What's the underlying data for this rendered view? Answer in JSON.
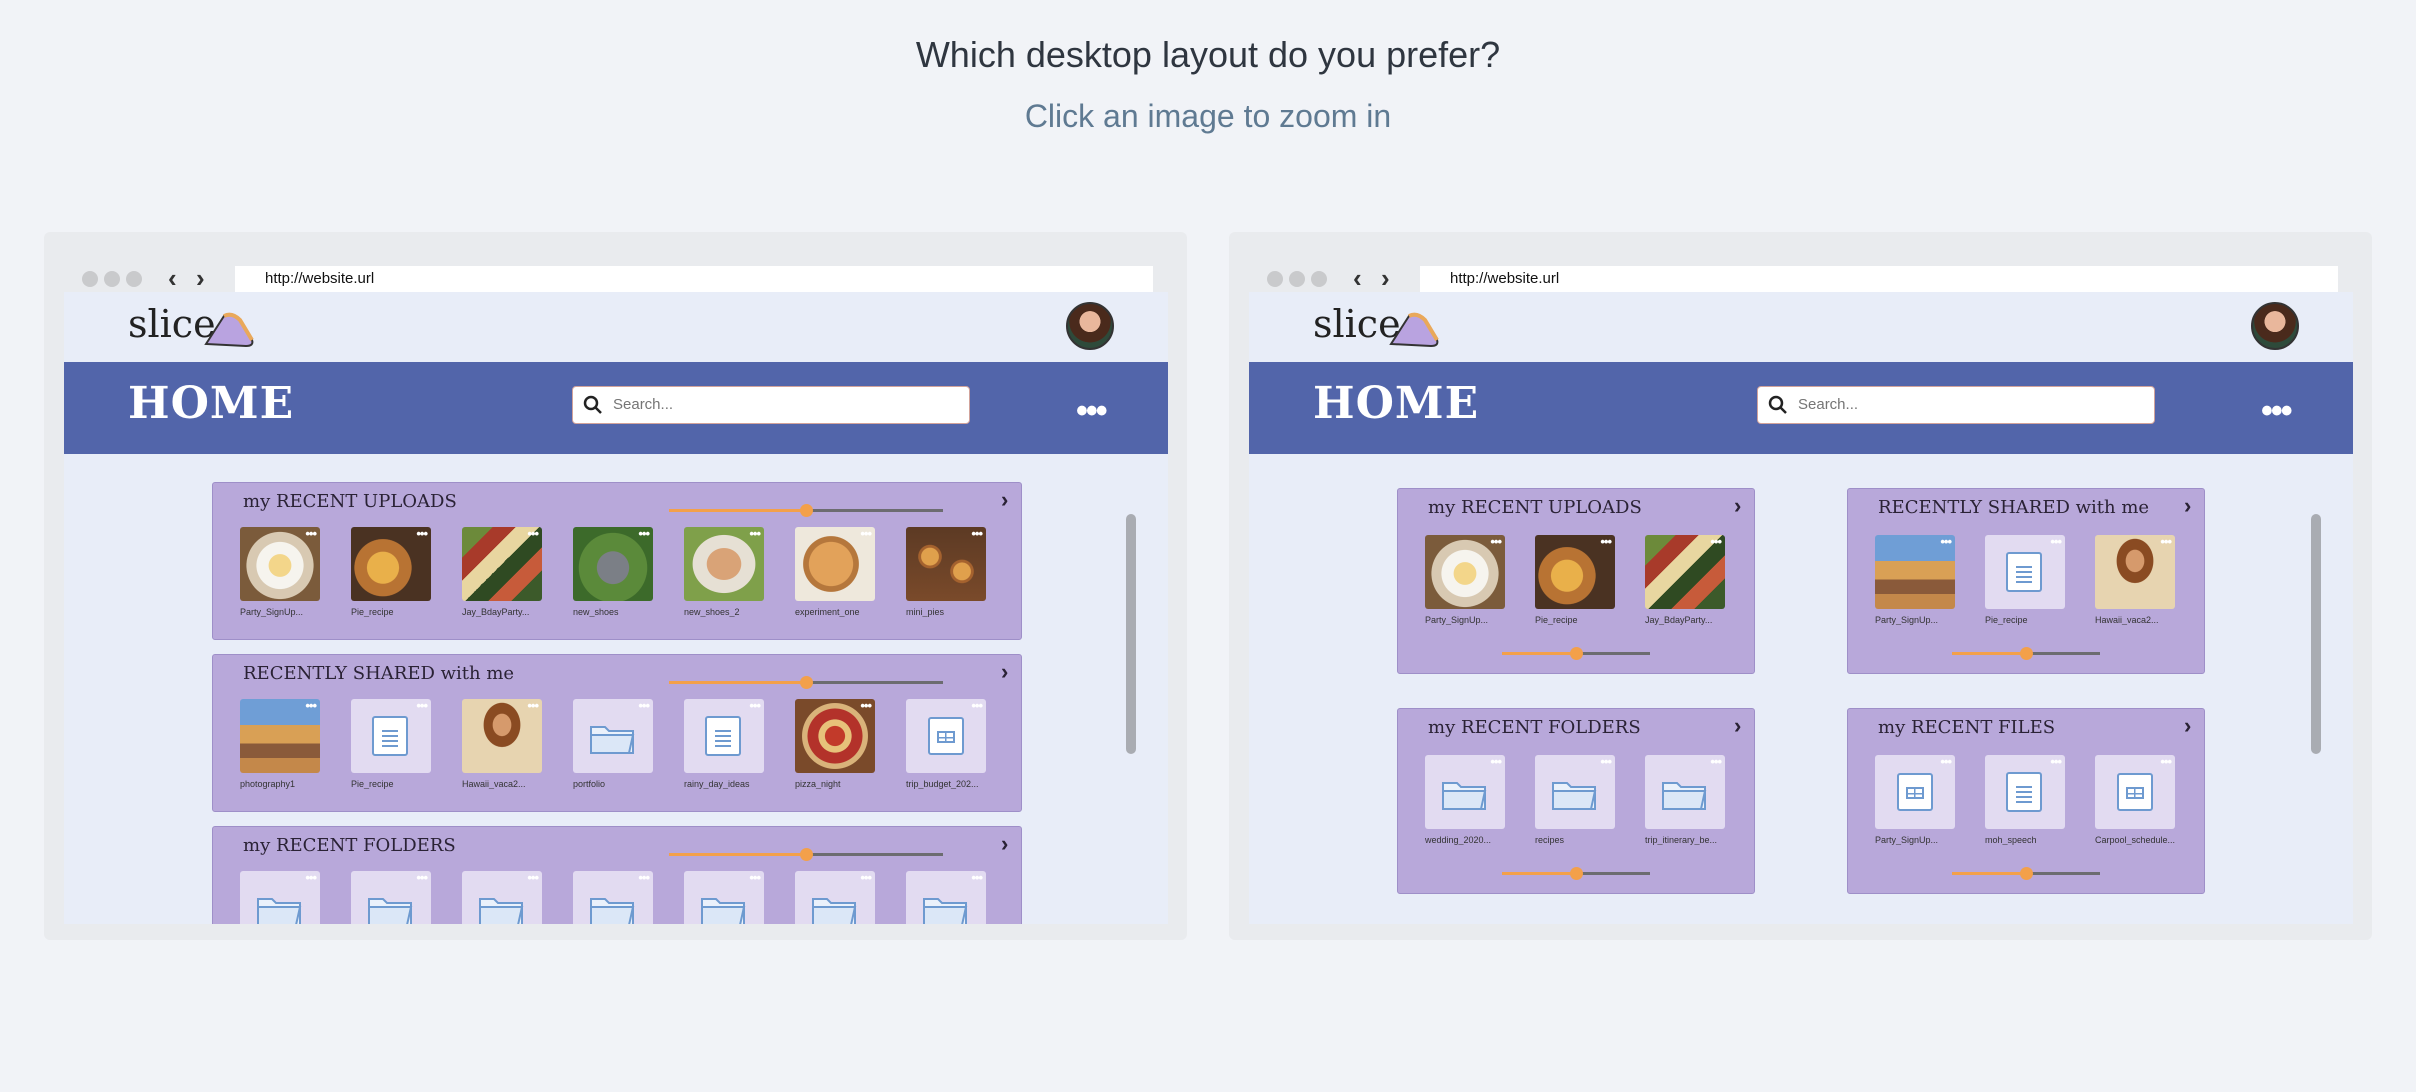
{
  "page": {
    "question": "Which desktop layout do you prefer?",
    "instruction": "Click an image to zoom in"
  },
  "browser": {
    "url": "http://website.url",
    "back_icon": "chevron-left-icon",
    "forward_icon": "chevron-right-icon"
  },
  "site": {
    "logo_text": "slice",
    "logo_icon": "pie-slice-icon",
    "header_title": "HOME",
    "search_placeholder": "Search...",
    "more_icon": "more-dots-icon",
    "colors": {
      "header": "#5265aa",
      "panel": "#b8a8da",
      "accent": "#f3a04a",
      "background": "#e8edf8"
    }
  },
  "layout_a": {
    "sections": [
      {
        "title": "my RECENT UPLOADS",
        "slider_value": 0.5,
        "items": [
          {
            "label": "Party_SignUp...",
            "kind": "image",
            "img": "food1"
          },
          {
            "label": "Pie_recipe",
            "kind": "image",
            "img": "food2"
          },
          {
            "label": "Jay_BdayParty...",
            "kind": "image",
            "img": "food3"
          },
          {
            "label": "new_shoes",
            "kind": "image",
            "img": "shoe1"
          },
          {
            "label": "new_shoes_2",
            "kind": "image",
            "img": "shoe2"
          },
          {
            "label": "experiment_one",
            "kind": "image",
            "img": "pie"
          },
          {
            "label": "mini_pies",
            "kind": "image",
            "img": "minipies"
          }
        ]
      },
      {
        "title": "RECENTLY SHARED with me",
        "slider_value": 0.5,
        "items": [
          {
            "label": "photography1",
            "kind": "image",
            "img": "city"
          },
          {
            "label": "Pie_recipe",
            "kind": "doc"
          },
          {
            "label": "Hawaii_vaca2...",
            "kind": "image",
            "img": "woman"
          },
          {
            "label": "portfolio",
            "kind": "folder"
          },
          {
            "label": "rainy_day_ideas",
            "kind": "doc"
          },
          {
            "label": "pizza_night",
            "kind": "image",
            "img": "pizza"
          },
          {
            "label": "trip_budget_202...",
            "kind": "sheet"
          }
        ]
      },
      {
        "title": "my RECENT FOLDERS",
        "slider_value": 0.5,
        "items": [
          {
            "label": "",
            "kind": "folder"
          },
          {
            "label": "",
            "kind": "folder"
          },
          {
            "label": "",
            "kind": "folder"
          },
          {
            "label": "",
            "kind": "folder"
          },
          {
            "label": "",
            "kind": "folder"
          },
          {
            "label": "",
            "kind": "folder"
          },
          {
            "label": "",
            "kind": "folder"
          }
        ]
      }
    ]
  },
  "layout_b": {
    "sections": [
      {
        "title": "my RECENT UPLOADS",
        "slider_value": 0.5,
        "items": [
          {
            "label": "Party_SignUp...",
            "kind": "image",
            "img": "food1"
          },
          {
            "label": "Pie_recipe",
            "kind": "image",
            "img": "food2"
          },
          {
            "label": "Jay_BdayParty...",
            "kind": "image",
            "img": "food3"
          }
        ]
      },
      {
        "title": "RECENTLY SHARED with me",
        "slider_value": 0.5,
        "items": [
          {
            "label": "Party_SignUp...",
            "kind": "image",
            "img": "city"
          },
          {
            "label": "Pie_recipe",
            "kind": "doc"
          },
          {
            "label": "Hawaii_vaca2...",
            "kind": "image",
            "img": "woman"
          }
        ]
      },
      {
        "title": "my RECENT FOLDERS",
        "slider_value": 0.5,
        "items": [
          {
            "label": "wedding_2020...",
            "kind": "folder"
          },
          {
            "label": "recipes",
            "kind": "folder"
          },
          {
            "label": "trip_itinerary_be...",
            "kind": "folder"
          }
        ]
      },
      {
        "title": "my RECENT FILES",
        "slider_value": 0.5,
        "items": [
          {
            "label": "Party_SignUp...",
            "kind": "sheet"
          },
          {
            "label": "moh_speech",
            "kind": "doc"
          },
          {
            "label": "Carpool_schedule...",
            "kind": "sheet"
          }
        ]
      }
    ]
  }
}
